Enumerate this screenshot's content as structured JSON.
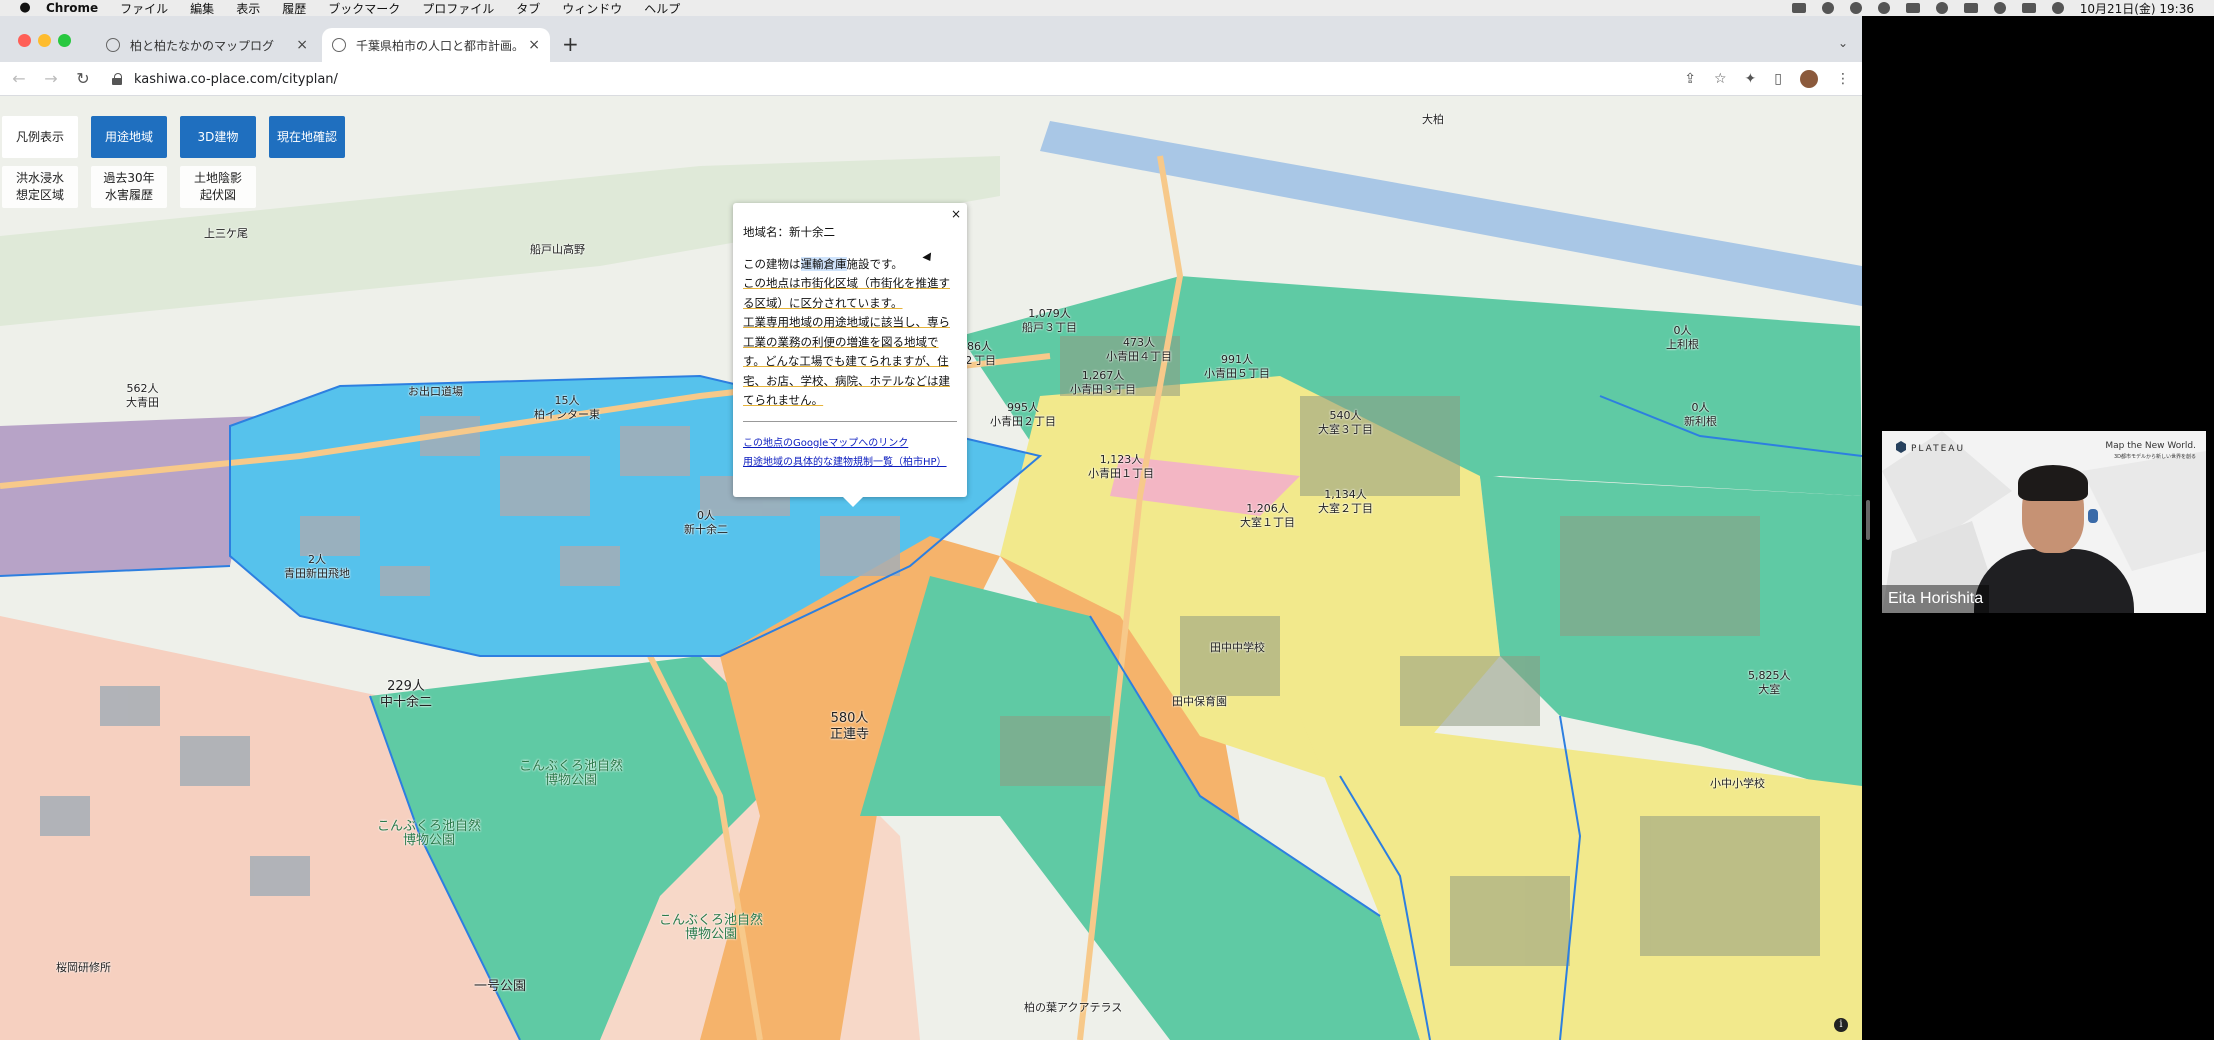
{
  "menubar": {
    "app": "Chrome",
    "items": [
      "ファイル",
      "編集",
      "表示",
      "履歴",
      "ブックマーク",
      "プロファイル",
      "タブ",
      "ウィンドウ",
      "ヘルプ"
    ],
    "clock": "10月21日(金) 19:36"
  },
  "tabs": [
    {
      "title": "柏と柏たなかのマップログ",
      "active": false
    },
    {
      "title": "千葉県柏市の人口と都市計画。安",
      "active": true
    }
  ],
  "address": {
    "url": "kashiwa.co-place.com/cityplan/"
  },
  "map_buttons": {
    "legend": "凡例表示",
    "zoning": "用途地域",
    "buildings3d": "3D建物",
    "location": "現在地確認",
    "flood_line1": "洪水浸水",
    "flood_line2": "想定区域",
    "past30_line1": "過去30年",
    "past30_line2": "水害履歴",
    "relief_line1": "土地陰影",
    "relief_line2": "起伏図"
  },
  "popup": {
    "close": "×",
    "area_name": "地域名：新十余二",
    "line1_pre": "この建物は",
    "line1_hl": "運輸倉庫",
    "line1_post": "施設です。",
    "line2": "この地点は市街化区域（市街化を推進する区域）に区分されています。",
    "line3": "工業専用地域の用途地域に該当し、専ら工業の業務の利便の増進を図る地域です。どんな工場でも建てられますが、住宅、お店、学校、病院、ホテルなどは建てられません。",
    "link1": "この地点のGoogleマップへのリンク",
    "link2": "用途地域の具体的な建物規制一覧（柏市HP）"
  },
  "map_labels": [
    {
      "pop": "0人",
      "name": "新十余二"
    },
    {
      "pop": "2人",
      "name": "青田新田飛地"
    },
    {
      "pop": "229人",
      "name": "中十余二"
    },
    {
      "pop": "580人",
      "name": "正連寺"
    },
    {
      "pop": "15人",
      "name": "柏インター東"
    },
    {
      "pop": "562人",
      "name": "大青田"
    },
    {
      "pop": "1,079人",
      "name": "船戸３丁目"
    },
    {
      "pop": "473人",
      "name": "小青田４丁目"
    },
    {
      "pop": "991人",
      "name": "小青田５丁目"
    },
    {
      "pop": "1,267人",
      "name": "小青田３丁目"
    },
    {
      "pop": "995人",
      "name": "小青田２丁目"
    },
    {
      "pop": "1,123人",
      "name": "小青田１丁目"
    },
    {
      "pop": "540人",
      "name": "大室３丁目"
    },
    {
      "pop": "1,134人",
      "name": "大室２丁目"
    },
    {
      "pop": "1,206人",
      "name": "大室１丁目"
    },
    {
      "pop": "0人",
      "name": "上利根"
    },
    {
      "pop": "0人",
      "name": "新利根"
    },
    {
      "pop": "5,825人",
      "name": "大室"
    },
    {
      "pop": "86人",
      "name": "２丁目"
    }
  ],
  "place_names": {
    "kamisangaoka": "上三ケ尾",
    "funado": "船戸山高野",
    "oojin": "お出口道場",
    "konbukuro1": "こんぶくろ池自然博物公園",
    "konbukuro2": "こんぶくろ池自然博物公園",
    "konbukuro3": "こんぶくろ池自然博物公園",
    "tanakajh": "田中中学校",
    "tanaka_park": "田中保育園",
    "chuo_school": "小中小学校",
    "oomuro_label": "大柏",
    "kashiwa_aqua": "柏の葉アクアテラス",
    "ichiba": "一号公園",
    "sakado": "桜岡研修所"
  },
  "video": {
    "brand": "PLATEAU",
    "tagline": "Map the New World.",
    "tagline_sub": "3D都市モデルから新しい世界を創る",
    "speaker": "Eita Horishita"
  },
  "colors": {
    "industrial_blue": "#56c2ec",
    "residential_green": "#5fcaa4",
    "commercial_orange": "#f5b36b",
    "residential_yellow": "#f2e98c",
    "lowrise_pink": "#f6d0c0",
    "purple": "#b7a3c7",
    "accent_blue": "#1f6fbf"
  }
}
